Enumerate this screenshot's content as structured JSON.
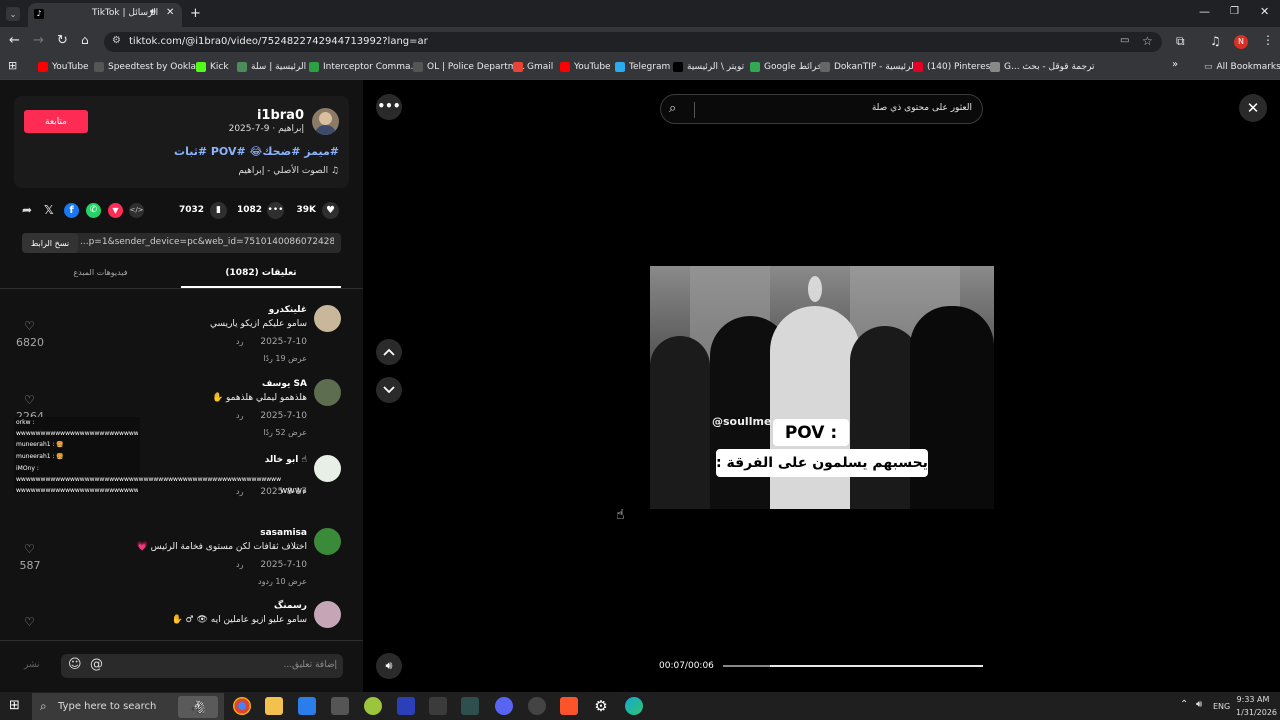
{
  "browser": {
    "tab_title": "TikTok | الرسائل",
    "url": "tiktok.com/@i1bra0/video/7524822742944713992?lang=ar",
    "bookmarks": [
      "YouTube",
      "Speedtest by Ookla...",
      "Kick",
      "الرئيسية | سلة",
      "Interceptor Comma...",
      "OL | Police Departm...",
      "Gmail",
      "YouTube",
      "Telegram",
      "تويتر \\ الرئيسية",
      "Google خرائط",
      "DokanTIP - الرئيسية",
      "(140) Pinterest",
      "G... ترجمة قوقل - بحث"
    ],
    "all_bookmarks": "All Bookmarks",
    "profile_initial": "N"
  },
  "post": {
    "username": "i1bra0",
    "meta": "إبراهيم · 9-7-2025",
    "follow_label": "متابعة",
    "hashtags": "#ميمز #ضحك😂 #POV #ثبات",
    "sound": "♫ الصوت الأصلي - إبراهيم",
    "likes": "39K",
    "comments": "1082",
    "saves": "7032",
    "link_text": "...p=1&sender_device=pc&web_id=7510140086072428037",
    "copy_link_label": "نسخ الرابط",
    "tab_comments": "تعليقات (1082)",
    "tab_creator_videos": "فيديوهات المبدع"
  },
  "comments": [
    {
      "user": "غلينكدرو",
      "text": "سامو عليكم ازيكو ياريسي",
      "date": "2025-7-10",
      "reply": "رد",
      "view_replies": "عرض 19 ردًا",
      "likes": "6820"
    },
    {
      "user": "يوسف SA",
      "text": "هلذهمو ليملي هلذهمو ✋",
      "date": "2025-7-10",
      "reply": "رد",
      "view_replies": "عرض 52 ردًا",
      "likes": "2264"
    },
    {
      "user": "ابو خالد ☝",
      "text": "",
      "date": "2025-8-17",
      "reply": "رد",
      "view_replies": "",
      "likes": ""
    },
    {
      "user": "sasamisa",
      "text": "اختلاف ثقافات لكن مستوى فخامة الرئيس 💗",
      "date": "2025-7-10",
      "reply": "رد",
      "view_replies": "عرض 10 ردود",
      "likes": "587"
    },
    {
      "user": "رسمنگ",
      "text": "سامو عليو ازيو عاملين ايه 👁 ♂ ✋",
      "date": "",
      "reply": "",
      "view_replies": "",
      "likes": ""
    }
  ],
  "chat_overlay": {
    "lines": [
      "orkw :",
      "wwwwwwwwwwwwwwwwwwwwwwwwwwwwwwww",
      "muneerah1 : 🍔",
      "muneerah1 : 🍔",
      "iMOny :",
      "wwwwwwwwwwwwwwwwwwwwwwwwwwwwwwwwwwwwwwwwwwwwwwwwwwwwwwwwwwwwwwwwwwwwwwwwwwwwwwwww",
      "wwwwwwwwwwwwwwwwwwwwwwwwwwwwwwwwwww"
    ],
    "tail_text": "wwwه."
  },
  "comment_input": {
    "placeholder": "إضافة تعليق...",
    "post_label": "نشر"
  },
  "video": {
    "search_placeholder": "العثور على محتوى ذي صلة",
    "watermark": "@soullme",
    "caption_pov": "POV :",
    "caption_text": "يحسبهم يسلمون على الفرقة :",
    "time": "00:07/00:06",
    "progress": 0.18
  },
  "taskbar": {
    "search_placeholder": "Type here to search",
    "lang": "ENG",
    "time": "9:33 AM",
    "date": "1/31/2026"
  },
  "colors": {
    "accent": "#fe2c55",
    "hashtag": "#8ab4ff",
    "background": "#121212"
  }
}
